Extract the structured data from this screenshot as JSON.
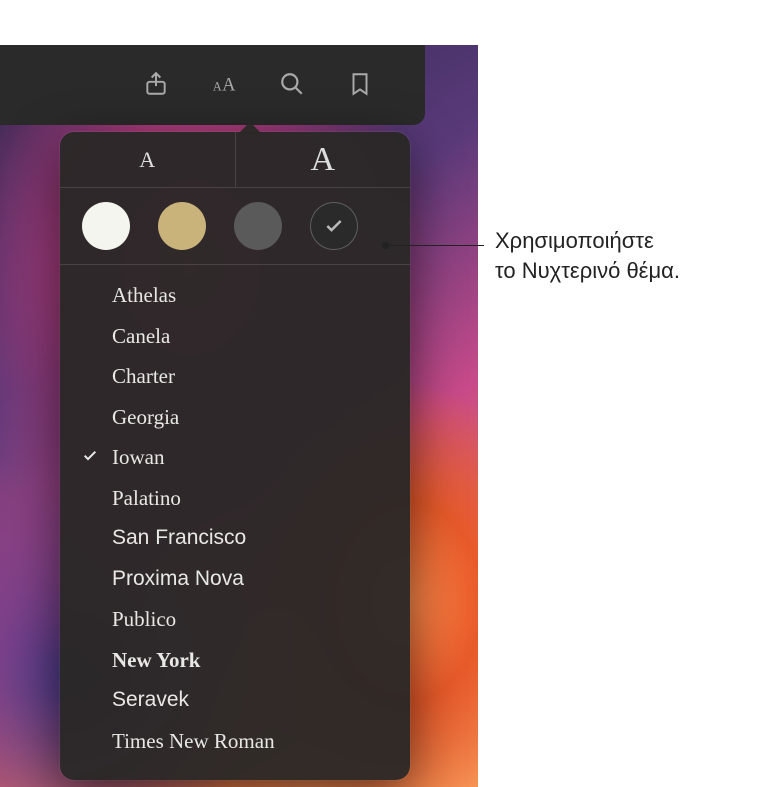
{
  "toolbar": {
    "share_icon": "share-icon",
    "appearance_icon": "text-appearance-icon",
    "search_icon": "search-icon",
    "bookmark_icon": "bookmark-icon"
  },
  "popover": {
    "text_size": {
      "small_label": "A",
      "large_label": "A"
    },
    "themes": [
      {
        "name": "white",
        "selected": false
      },
      {
        "name": "sepia",
        "selected": false
      },
      {
        "name": "gray",
        "selected": false
      },
      {
        "name": "night",
        "selected": true
      }
    ],
    "fonts": [
      {
        "label": "Athelas",
        "selected": false,
        "class": "font-athelas"
      },
      {
        "label": "Canela",
        "selected": false,
        "class": "font-canela"
      },
      {
        "label": "Charter",
        "selected": false,
        "class": "font-charter"
      },
      {
        "label": "Georgia",
        "selected": false,
        "class": "font-georgia"
      },
      {
        "label": "Iowan",
        "selected": true,
        "class": "font-iowan"
      },
      {
        "label": "Palatino",
        "selected": false,
        "class": "font-palatino"
      },
      {
        "label": "San Francisco",
        "selected": false,
        "class": "font-sanfrancisco"
      },
      {
        "label": "Proxima Nova",
        "selected": false,
        "class": "font-proxima"
      },
      {
        "label": "Publico",
        "selected": false,
        "class": "font-publico"
      },
      {
        "label": "New York",
        "selected": false,
        "class": "font-newyork"
      },
      {
        "label": "Seravek",
        "selected": false,
        "class": "font-seravek"
      },
      {
        "label": "Times New Roman",
        "selected": false,
        "class": "font-times"
      }
    ]
  },
  "callout": {
    "line1": "Χρησιμοποιήστε",
    "line2": "το Νυχτερινό θέμα."
  }
}
